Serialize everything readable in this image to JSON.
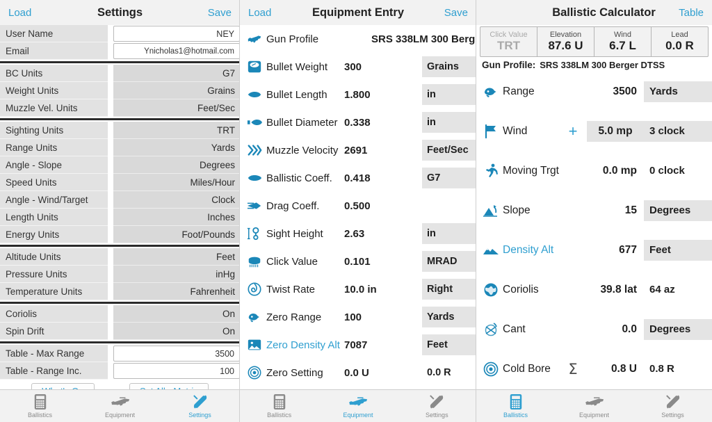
{
  "accent_color": "#2f9fd0",
  "settings": {
    "nav": {
      "load": "Load",
      "title": "Settings",
      "save": "Save"
    },
    "groups": [
      {
        "rows": [
          {
            "label": "User Name",
            "value": "NEY",
            "type": "input"
          },
          {
            "label": "Email",
            "value": "Ynicholas1@hotmail.com",
            "type": "input"
          }
        ]
      },
      {
        "rows": [
          {
            "label": "BC Units",
            "value": "G7",
            "type": "select"
          },
          {
            "label": "Weight Units",
            "value": "Grains",
            "type": "select"
          },
          {
            "label": "Muzzle Vel. Units",
            "value": "Feet/Sec",
            "type": "select"
          }
        ]
      },
      {
        "rows": [
          {
            "label": "Sighting Units",
            "value": "TRT",
            "type": "select"
          },
          {
            "label": "Range Units",
            "value": "Yards",
            "type": "select"
          },
          {
            "label": "Angle - Slope",
            "value": "Degrees",
            "type": "select"
          },
          {
            "label": "Speed Units",
            "value": "Miles/Hour",
            "type": "select"
          },
          {
            "label": "Angle - Wind/Target",
            "value": "Clock",
            "type": "select"
          },
          {
            "label": "Length Units",
            "value": "Inches",
            "type": "select"
          },
          {
            "label": "Energy Units",
            "value": "Foot/Pounds",
            "type": "select"
          }
        ]
      },
      {
        "rows": [
          {
            "label": "Altitude Units",
            "value": "Feet",
            "type": "select"
          },
          {
            "label": "Pressure Units",
            "value": "inHg",
            "type": "select"
          },
          {
            "label": "Temperature Units",
            "value": "Fahrenheit",
            "type": "select"
          }
        ]
      },
      {
        "rows": [
          {
            "label": "Coriolis",
            "value": "On",
            "type": "select"
          },
          {
            "label": "Spin Drift",
            "value": "On",
            "type": "select"
          }
        ]
      },
      {
        "rows": [
          {
            "label": "Table - Max Range",
            "value": "3500",
            "type": "input"
          },
          {
            "label": "Table - Range Inc.",
            "value": "100",
            "type": "input"
          }
        ]
      }
    ],
    "buttons": {
      "whats_on": "What's On",
      "set_all_metric": "Set All - Metric"
    },
    "tabs": [
      {
        "label": "Ballistics",
        "icon": "calculator-icon",
        "active": false
      },
      {
        "label": "Equipment",
        "icon": "rifle-icon",
        "active": false
      },
      {
        "label": "Settings",
        "icon": "tools-icon",
        "active": true
      }
    ]
  },
  "equipment": {
    "nav": {
      "load": "Load",
      "title": "Equipment Entry",
      "save": "Save"
    },
    "rows": [
      {
        "icon": "rifle-icon",
        "label": "Gun Profile",
        "value": "SRS 338LM 300 Berg",
        "unit": "",
        "profile": true
      },
      {
        "icon": "scale-icon",
        "label": "Bullet Weight",
        "value": "300",
        "unit": "Grains"
      },
      {
        "icon": "bullet-side-icon",
        "label": "Bullet Length",
        "value": "1.800",
        "unit": "in"
      },
      {
        "icon": "bullet-diameter-icon",
        "label": "Bullet Diameter",
        "value": "0.338",
        "unit": "in"
      },
      {
        "icon": "chevrons-right-icon",
        "label": "Muzzle Velocity",
        "value": "2691",
        "unit": "Feet/Sec"
      },
      {
        "icon": "bullet-blunt-icon",
        "label": "Ballistic Coeff.",
        "value": "0.418",
        "unit": "G7"
      },
      {
        "icon": "drag-arrow-icon",
        "label": "Drag Coeff.",
        "value": "0.500",
        "unit": ""
      },
      {
        "icon": "sight-height-icon",
        "label": "Sight Height",
        "value": "2.63",
        "unit": "in"
      },
      {
        "icon": "turret-icon",
        "label": "Click Value",
        "value": "0.101",
        "unit": "MRAD"
      },
      {
        "icon": "twist-spiral-icon",
        "label": "Twist Rate",
        "value": "10.0 in",
        "unit": "Right"
      },
      {
        "icon": "zero-range-icon",
        "label": "Zero Range",
        "value": "100",
        "unit": "Yards"
      },
      {
        "icon": "mountain-photo-icon",
        "label": "Zero Density Alt",
        "value": "7087",
        "unit": "Feet",
        "link": true
      },
      {
        "icon": "target-dot-icon",
        "label": "Zero Setting",
        "value": "0.0 U",
        "unit": "0.0 R",
        "unit_plain": true
      }
    ],
    "tabs": [
      {
        "label": "Ballistics",
        "icon": "calculator-icon",
        "active": false
      },
      {
        "label": "Equipment",
        "icon": "rifle-icon",
        "active": true
      },
      {
        "label": "Settings",
        "icon": "tools-icon",
        "active": false
      }
    ]
  },
  "calculator": {
    "nav": {
      "title": "Ballistic Calculator",
      "table": "Table"
    },
    "summary": [
      {
        "label": "Click Value",
        "value": "TRT",
        "disabled": true
      },
      {
        "label": "Elevation",
        "value": "87.6 U",
        "disabled": false
      },
      {
        "label": "Wind",
        "value": "6.7 L",
        "disabled": false
      },
      {
        "label": "Lead",
        "value": "0.0 R",
        "disabled": false
      }
    ],
    "profile": {
      "label": "Gun Profile:",
      "value": "SRS 338LM 300 Berger DTSS"
    },
    "rows": [
      {
        "icon": "zero-range-icon",
        "label": "Range",
        "mid": "",
        "v1": "3500",
        "v1_chip": false,
        "v2": "Yards",
        "v2_chip": true
      },
      {
        "icon": "flag-icon",
        "label": "Wind",
        "mid": "+",
        "mid_type": "plus",
        "v1": "5.0 mp",
        "v1_chip": true,
        "v2": "3 clock",
        "v2_chip": true
      },
      {
        "icon": "runner-icon",
        "label": "Moving Trgt",
        "mid": "",
        "v1": "0.0 mp",
        "v1_chip": false,
        "v2": "0 clock",
        "v2_chip": false
      },
      {
        "icon": "slope-icon",
        "label": "Slope",
        "mid": "",
        "v1": "15",
        "v1_chip": false,
        "v2": "Degrees",
        "v2_chip": true
      },
      {
        "icon": "mountains-icon",
        "label": "Density Alt",
        "mid": "",
        "v1": "677",
        "v1_chip": false,
        "v2": "Feet",
        "v2_chip": true,
        "link": true
      },
      {
        "icon": "globe-icon",
        "label": "Coriolis",
        "mid": "",
        "v1": "39.8 lat",
        "v1_chip": false,
        "v2": "64 az",
        "v2_chip": false
      },
      {
        "icon": "cant-icon",
        "label": "Cant",
        "mid": "",
        "v1": "0.0",
        "v1_chip": false,
        "v2": "Degrees",
        "v2_chip": true
      },
      {
        "icon": "target-dot-icon",
        "label": "Cold Bore",
        "mid": "Σ",
        "mid_type": "sigma",
        "v1": "0.8 U",
        "v1_chip": false,
        "v2": "0.8 R",
        "v2_chip": false
      }
    ],
    "tabs": [
      {
        "label": "Ballistics",
        "icon": "calculator-icon",
        "active": true
      },
      {
        "label": "Equipment",
        "icon": "rifle-icon",
        "active": false
      },
      {
        "label": "Settings",
        "icon": "tools-icon",
        "active": false
      }
    ]
  }
}
